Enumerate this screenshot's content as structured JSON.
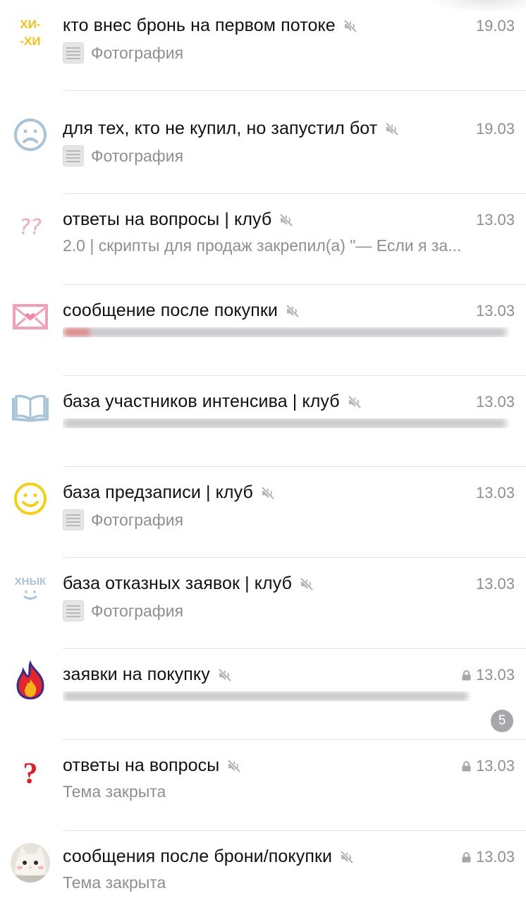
{
  "chats": [
    {
      "title": "кто внес бронь на первом потоке",
      "date": "19.03",
      "subtitle": "Фотография",
      "sub_type": "photo",
      "avatar": "hihi-sticker-icon",
      "locked": false
    },
    {
      "title": "для тех, кто не купил, но запустил бот",
      "date": "19.03",
      "subtitle": "Фотография",
      "sub_type": "photo",
      "avatar": "sad-face-icon",
      "locked": false
    },
    {
      "title": "ответы на вопросы | клуб",
      "date": "13.03",
      "subtitle": "2.0 | скрипты для продаж закрепил(а) \"— Если я за...",
      "sub_type": "text",
      "avatar": "question-marks-icon",
      "locked": false
    },
    {
      "title": "сообщение после покупки",
      "date": "13.03",
      "subtitle": "",
      "sub_type": "blurred",
      "avatar": "envelope-heart-icon",
      "locked": false
    },
    {
      "title": "база участников интенсива | клуб",
      "date": "13.03",
      "subtitle": "",
      "sub_type": "blurred",
      "avatar": "open-book-icon",
      "locked": false
    },
    {
      "title": "база предзаписи | клуб",
      "date": "13.03",
      "subtitle": "Фотография",
      "sub_type": "photo",
      "avatar": "smile-face-icon",
      "locked": false
    },
    {
      "title": "база отказных заявок | клуб",
      "date": "13.03",
      "subtitle": "Фотография",
      "sub_type": "photo",
      "avatar": "hnyk-sticker-icon",
      "locked": false
    },
    {
      "title": "заявки на покупку",
      "date": "13.03",
      "subtitle": "",
      "sub_type": "blurred",
      "avatar": "fire-icon",
      "locked": true,
      "badge": "5"
    },
    {
      "title": "ответы на вопросы",
      "date": "13.03",
      "subtitle": "Тема закрыта",
      "sub_type": "text",
      "avatar": "red-question-icon",
      "locked": true
    },
    {
      "title": "сообщения после брони/покупки",
      "date": "13.03",
      "subtitle": "Тема закрыта",
      "sub_type": "text",
      "avatar": "cat-photo-icon",
      "locked": true
    }
  ],
  "avatar_text": {
    "hihi_top": "ХИ-",
    "hihi_bottom": "-ХИ",
    "hnyk": "ХНЫК"
  },
  "colors": {
    "date": "#8e8e93",
    "title": "#111111",
    "separator": "#e3e3e6",
    "badge": "#a7a7ab"
  }
}
